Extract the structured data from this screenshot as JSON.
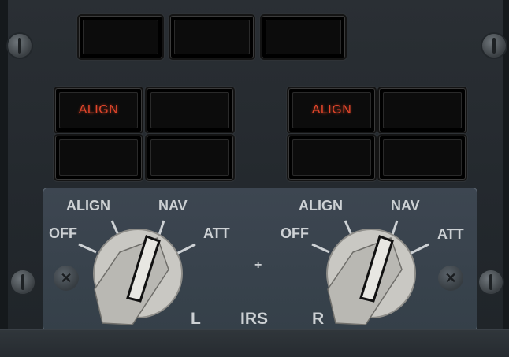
{
  "panel": {
    "colors": {
      "background": "#23282d",
      "plate": "#3d4651",
      "lamp_text": "#e0452b",
      "label": "#cdd1d4"
    }
  },
  "annunciators": {
    "top_row": [
      "",
      "",
      ""
    ],
    "left": [
      "ALIGN",
      "",
      "",
      ""
    ],
    "right": [
      "ALIGN",
      "",
      "",
      ""
    ]
  },
  "mode_selector": {
    "left": {
      "positions": [
        "OFF",
        "ALIGN",
        "NAV",
        "ATT"
      ],
      "selected": "NAV"
    },
    "right": {
      "positions": [
        "OFF",
        "ALIGN",
        "NAV",
        "ATT"
      ],
      "selected": "NAV"
    },
    "labels": {
      "left_side": "L",
      "center": "IRS",
      "right_side": "R"
    },
    "center_mark": "+"
  },
  "icons": [
    "slotted-screw-icon",
    "cross-screw-icon",
    "rotary-knob-icon"
  ]
}
